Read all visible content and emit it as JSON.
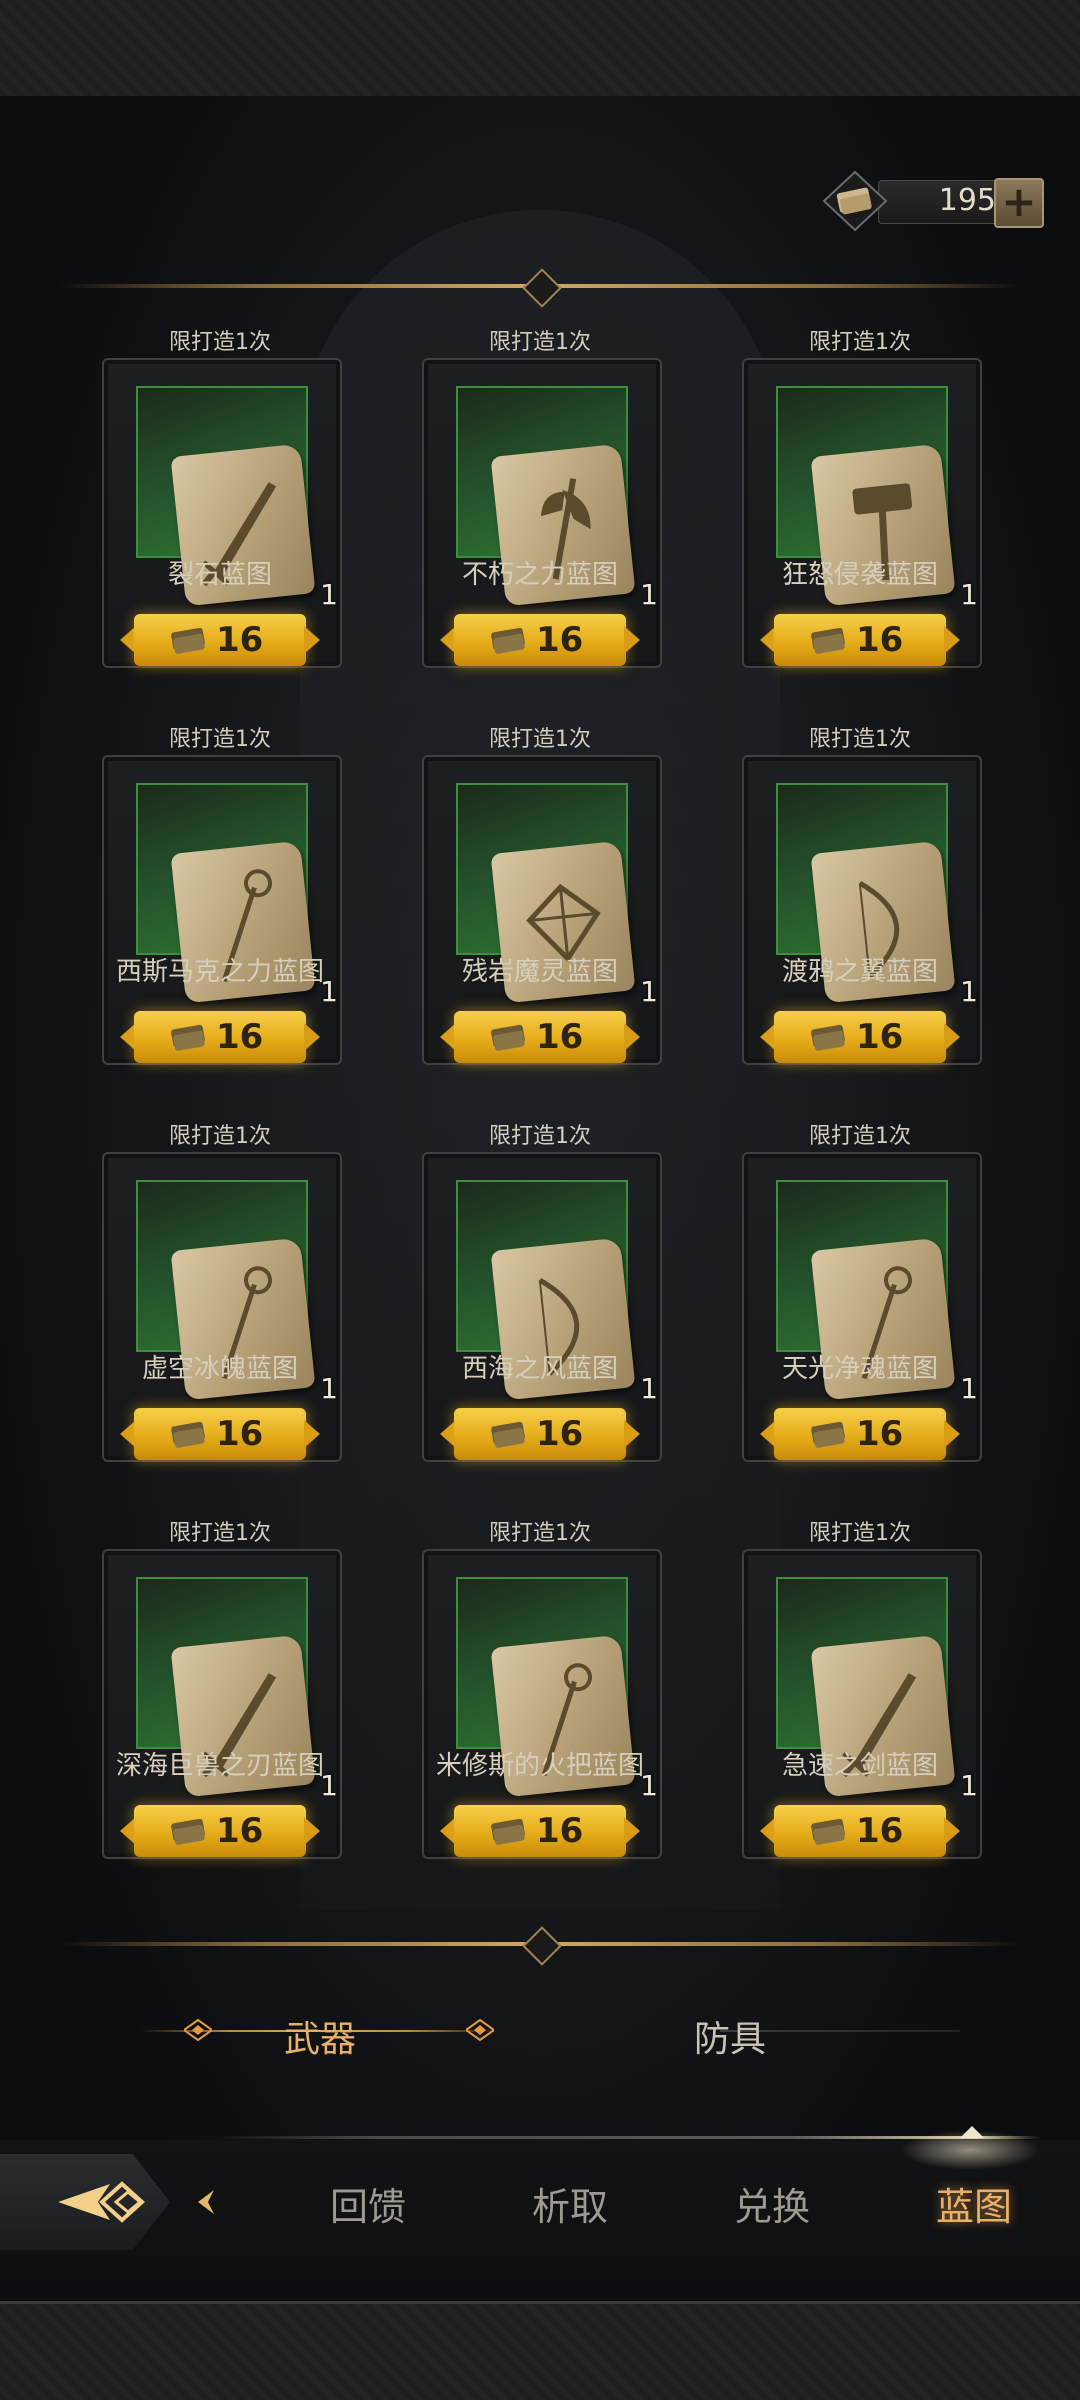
{
  "currency": {
    "icon": "blueprint-scroll-icon",
    "value": "195",
    "add_label": "+"
  },
  "items": [
    {
      "limit": "限打造1次",
      "name": "裂石蓝图",
      "qty": "1",
      "price": "16",
      "icon": "sword"
    },
    {
      "limit": "限打造1次",
      "name": "不朽之力蓝图",
      "qty": "1",
      "price": "16",
      "icon": "axe"
    },
    {
      "limit": "限打造1次",
      "name": "狂怒侵袭蓝图",
      "qty": "1",
      "price": "16",
      "icon": "hammer"
    },
    {
      "limit": "限打造1次",
      "name": "西斯马克之力蓝图",
      "qty": "1",
      "price": "16",
      "icon": "staff"
    },
    {
      "limit": "限打造1次",
      "name": "残岩魔灵蓝图",
      "qty": "1",
      "price": "16",
      "icon": "shield"
    },
    {
      "limit": "限打造1次",
      "name": "渡鸦之翼蓝图",
      "qty": "1",
      "price": "16",
      "icon": "bow"
    },
    {
      "limit": "限打造1次",
      "name": "虚空冰魄蓝图",
      "qty": "1",
      "price": "16",
      "icon": "staff"
    },
    {
      "limit": "限打造1次",
      "name": "西海之风蓝图",
      "qty": "1",
      "price": "16",
      "icon": "bow"
    },
    {
      "limit": "限打造1次",
      "name": "天光净魂蓝图",
      "qty": "1",
      "price": "16",
      "icon": "staff"
    },
    {
      "limit": "限打造1次",
      "name": "深海巨兽之刃蓝图",
      "qty": "1",
      "price": "16",
      "icon": "sword"
    },
    {
      "limit": "限打造1次",
      "name": "米修斯的火把蓝图",
      "qty": "1",
      "price": "16",
      "icon": "staff"
    },
    {
      "limit": "限打造1次",
      "name": "急速之剑蓝图",
      "qty": "1",
      "price": "16",
      "icon": "sword"
    }
  ],
  "tabs": {
    "weapon": "武器",
    "armor": "防具",
    "active": "weapon"
  },
  "nav": {
    "items": [
      "回馈",
      "析取",
      "兑换",
      "蓝图"
    ],
    "active_index": 3
  },
  "colors": {
    "accent_gold": "#e9b06a",
    "price_button": "#e3a916",
    "slot_green": "#2f7a33"
  }
}
